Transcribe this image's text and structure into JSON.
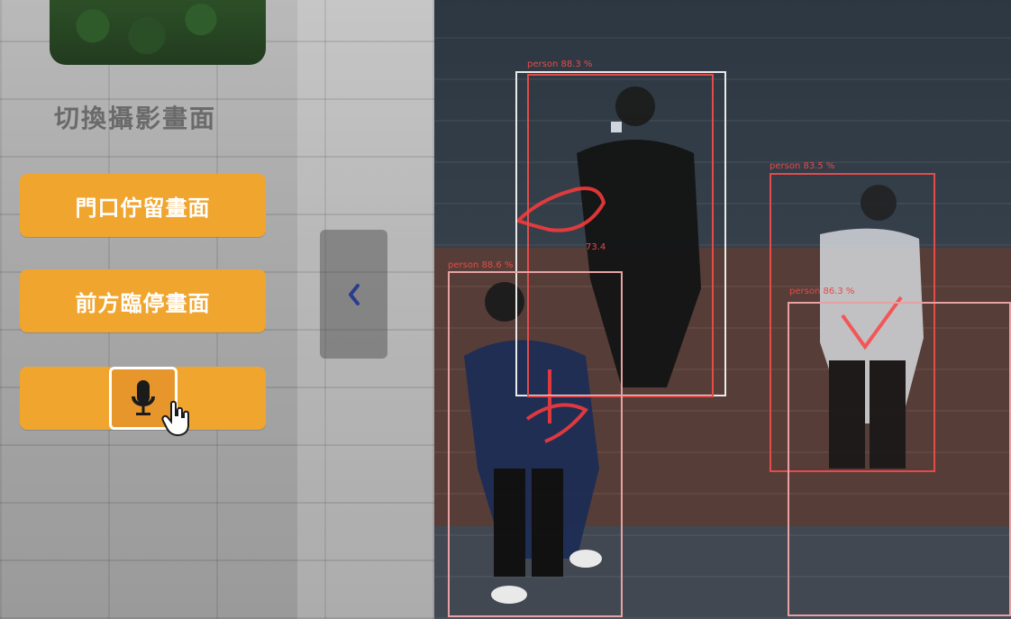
{
  "panel": {
    "title": "切換攝影畫面",
    "buttons": [
      {
        "label": "門口佇留畫面"
      },
      {
        "label": "前方臨停畫面"
      },
      {
        "label": ""
      }
    ]
  },
  "icons": {
    "mic": "microphone-icon",
    "cursor": "hand-pointer-icon",
    "collapse": "chevron-left-icon"
  },
  "colors": {
    "button": "#f0a52f",
    "bbox_red": "#e44b4b",
    "bbox_white": "#e9e9e9"
  },
  "detections": [
    {
      "label": "person 88.3 %",
      "score": "73.4"
    },
    {
      "label": "person 88.6 %"
    },
    {
      "label": "person 83.5 %"
    },
    {
      "label": "person 86.3 %"
    }
  ]
}
